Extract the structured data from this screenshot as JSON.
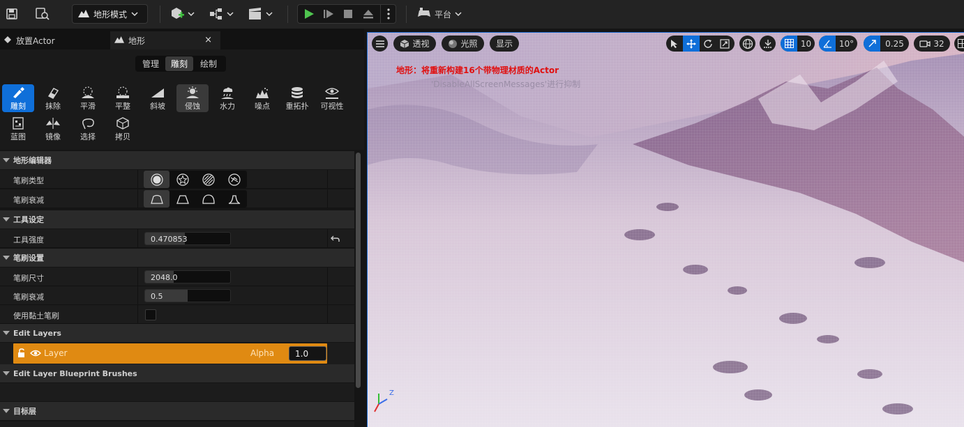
{
  "toolbar": {
    "mode_label": "地形模式",
    "platform_label": "平台"
  },
  "tabs": [
    {
      "label": "放置Actor"
    },
    {
      "label": "地形",
      "close": "×"
    }
  ],
  "mode_tabs": [
    "管理",
    "雕刻",
    "绘制"
  ],
  "tools_row1": [
    "雕刻",
    "抹除",
    "平滑",
    "平整",
    "斜坡",
    "侵蚀",
    "水力",
    "噪点",
    "重拓扑",
    "可视性"
  ],
  "tools_row2": [
    "蓝图",
    "镜像",
    "选择",
    "拷贝"
  ],
  "sections": {
    "landscape_editor": "地形编辑器",
    "tool_settings": "工具设定",
    "brush_settings": "笔刷设置",
    "edit_layers": "Edit Layers",
    "edit_layer_bp": "Edit Layer Blueprint Brushes",
    "target_layers": "目标层"
  },
  "props": {
    "brush_type": "笔刷类型",
    "brush_falloff_type": "笔刷衰减",
    "tool_strength": "工具强度",
    "tool_strength_value": "0.470853",
    "tool_strength_fraction": 0.47,
    "brush_size": "笔刷尺寸",
    "brush_size_value": "2048.0",
    "brush_size_fraction": 0.34,
    "brush_falloff": "笔刷衰减",
    "brush_falloff_value": "0.5",
    "brush_falloff_fraction": 0.5,
    "use_clay": "使用黏土笔刷"
  },
  "layer": {
    "name": "Layer",
    "alpha_label": "Alpha",
    "alpha_value": "1.0"
  },
  "viewport": {
    "perspective": "透视",
    "lit": "光照",
    "show": "显示",
    "grid_snap": "10",
    "rot_snap": "10°",
    "scale_snap": "0.25",
    "cam_speed": "32",
    "msg_line1": "地形：将重新构建16个带物理材质的Actor",
    "msg_line2": "'DisableAllScreenMessages'进行抑制",
    "axis_z": "Z",
    "msg_color": "#e01010",
    "accent": "#0f6fd9",
    "layer_row_color": "#e08a12"
  }
}
